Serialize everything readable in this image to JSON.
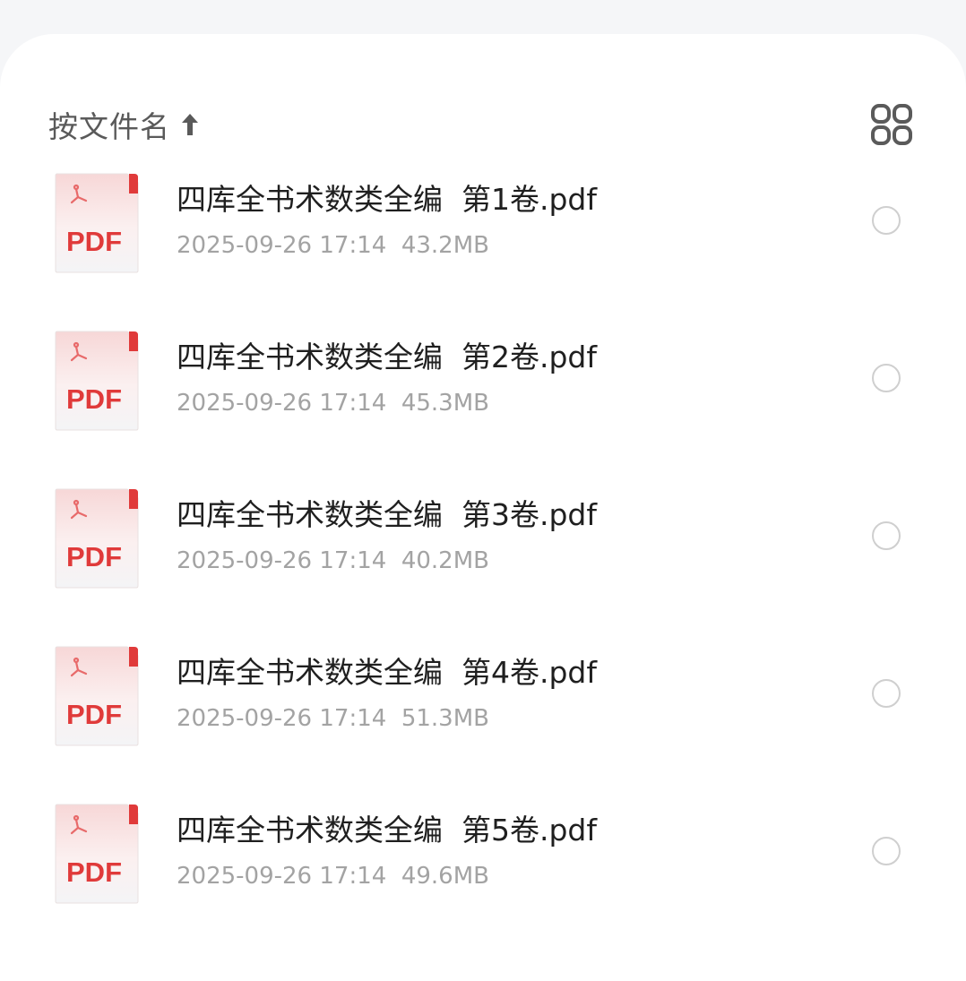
{
  "header": {
    "sort_label": "按文件名",
    "sort_arrow_icon": "arrow-up-icon",
    "view_toggle_icon": "grid-view-icon"
  },
  "files": [
    {
      "name": "四库全书术数类全编  第1卷.pdf",
      "meta": "2025-09-26 17:14  43.2MB",
      "icon": "pdf-file-icon",
      "icon_label": "PDF"
    },
    {
      "name": "四库全书术数类全编  第2卷.pdf",
      "meta": "2025-09-26 17:14  45.3MB",
      "icon": "pdf-file-icon",
      "icon_label": "PDF"
    },
    {
      "name": "四库全书术数类全编  第3卷.pdf",
      "meta": "2025-09-26 17:14  40.2MB",
      "icon": "pdf-file-icon",
      "icon_label": "PDF"
    },
    {
      "name": "四库全书术数类全编  第4卷.pdf",
      "meta": "2025-09-26 17:14  51.3MB",
      "icon": "pdf-file-icon",
      "icon_label": "PDF"
    },
    {
      "name": "四库全书术数类全编  第5卷.pdf",
      "meta": "2025-09-26 17:14  49.6MB",
      "icon": "pdf-file-icon",
      "icon_label": "PDF"
    }
  ],
  "colors": {
    "pdf_red": "#e03a3a",
    "pdf_bg_top": "#f8dede",
    "radio_border": "#cfcfcf",
    "text_primary": "#1f1f1f",
    "text_secondary": "#a3a3a3"
  }
}
